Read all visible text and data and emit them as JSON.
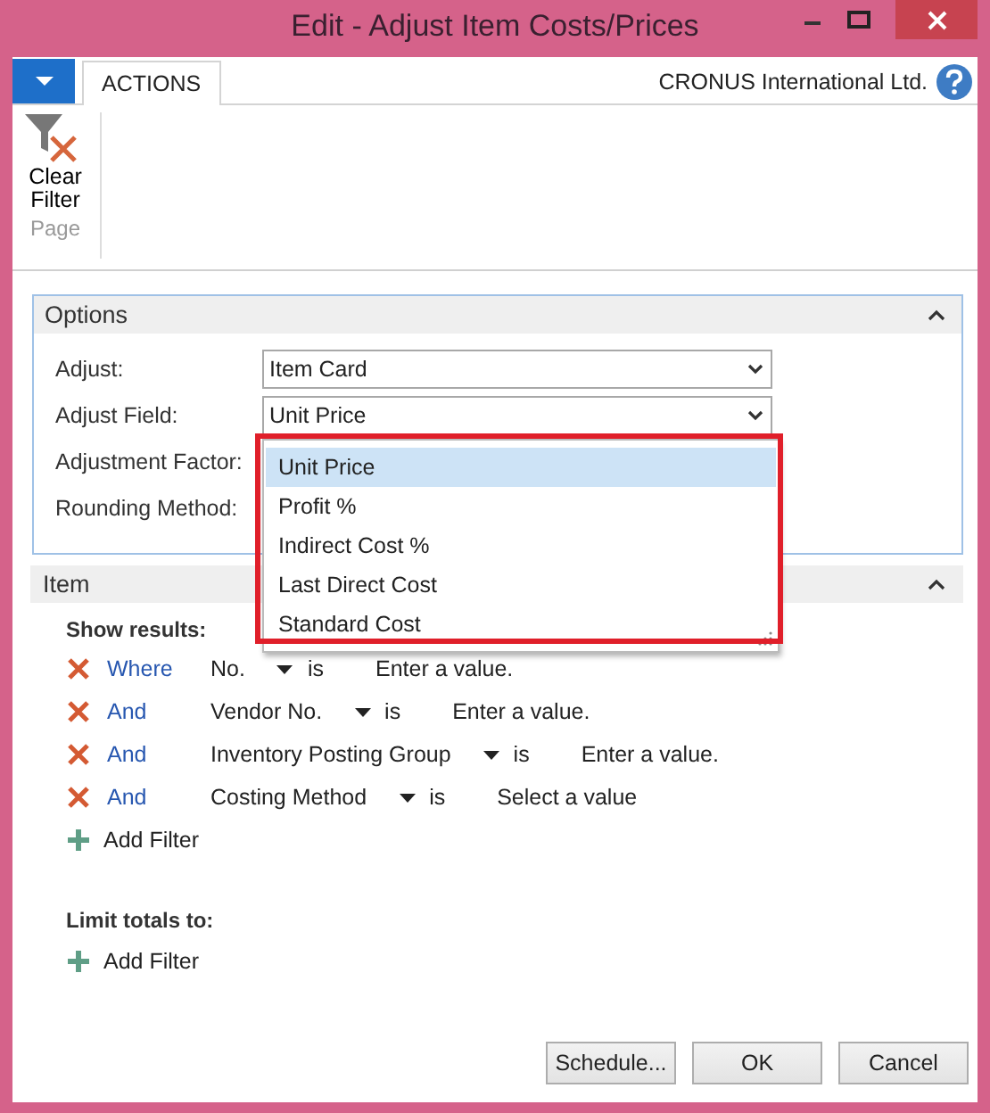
{
  "window": {
    "title": "Edit - Adjust Item Costs/Prices"
  },
  "ribbon": {
    "tabs": [
      {
        "label": "ACTIONS",
        "selected": true
      }
    ],
    "company": "CRONUS International Ltd.",
    "actions": [
      {
        "label": "Clear Filter"
      }
    ],
    "group": "Page"
  },
  "options": {
    "title": "Options",
    "expanded": true,
    "fields": [
      {
        "label": "Adjust:",
        "value": "Item Card"
      },
      {
        "label": "Adjust Field:",
        "value": "Unit Price"
      },
      {
        "label": "Adjustment Factor:"
      },
      {
        "label": "Rounding Method:"
      }
    ],
    "dropdown": {
      "highlighted": true,
      "items": [
        {
          "label": "Unit Price",
          "selected": true
        },
        {
          "label": "Profit %",
          "selected": false
        },
        {
          "label": "Indirect Cost %",
          "selected": false
        },
        {
          "label": "Last Direct Cost",
          "selected": false
        },
        {
          "label": "Standard Cost",
          "selected": false
        }
      ]
    }
  },
  "item": {
    "title": "Item",
    "expanded": true,
    "show_results_label": "Show results:",
    "filters": [
      {
        "conjunction": "Where",
        "field": "No.",
        "operator": "is",
        "value": "Enter a value."
      },
      {
        "conjunction": "And",
        "field": "Vendor No.",
        "operator": "is",
        "value": "Enter a value."
      },
      {
        "conjunction": "And",
        "field": "Inventory Posting Group",
        "operator": "is",
        "value": "Enter a value."
      },
      {
        "conjunction": "And",
        "field": "Costing Method",
        "operator": "is",
        "value": "Select a value"
      }
    ],
    "add_filter": "Add Filter",
    "limit_label": "Limit totals to:",
    "limit_add_filter": "Add Filter"
  },
  "buttons": [
    "Schedule...",
    "OK",
    "Cancel"
  ]
}
